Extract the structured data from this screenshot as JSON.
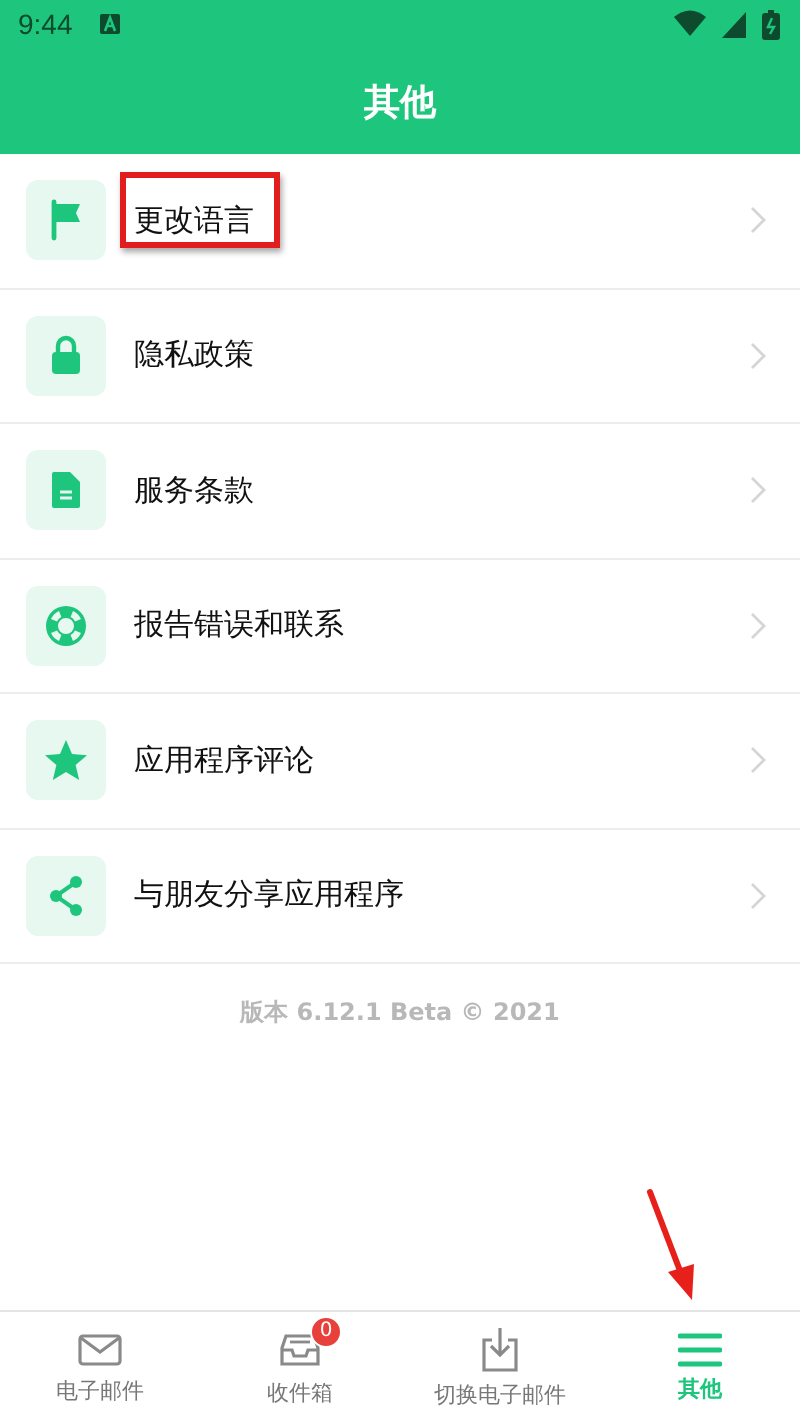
{
  "status_bar": {
    "time": "9:44"
  },
  "header": {
    "title": "其他"
  },
  "items": [
    {
      "kind": "flag",
      "label": "更改语言",
      "highlighted": true
    },
    {
      "kind": "lock",
      "label": "隐私政策",
      "highlighted": false
    },
    {
      "kind": "document",
      "label": "服务条款",
      "highlighted": false
    },
    {
      "kind": "lifebuoy",
      "label": "报告错误和联系",
      "highlighted": false
    },
    {
      "kind": "star",
      "label": "应用程序评论",
      "highlighted": false
    },
    {
      "kind": "share",
      "label": "与朋友分享应用程序",
      "highlighted": false
    }
  ],
  "version": "版本 6.12.1 Beta © 2021",
  "tabs": [
    {
      "kind": "mail",
      "label": "电子邮件",
      "selected": false,
      "pointed": false
    },
    {
      "kind": "inbox",
      "label": "收件箱",
      "badge": "0",
      "selected": false,
      "pointed": false
    },
    {
      "kind": "download",
      "label": "切换电子邮件",
      "selected": false,
      "pointed": false
    },
    {
      "kind": "menu",
      "label": "其他",
      "selected": true,
      "pointed": true
    }
  ]
}
